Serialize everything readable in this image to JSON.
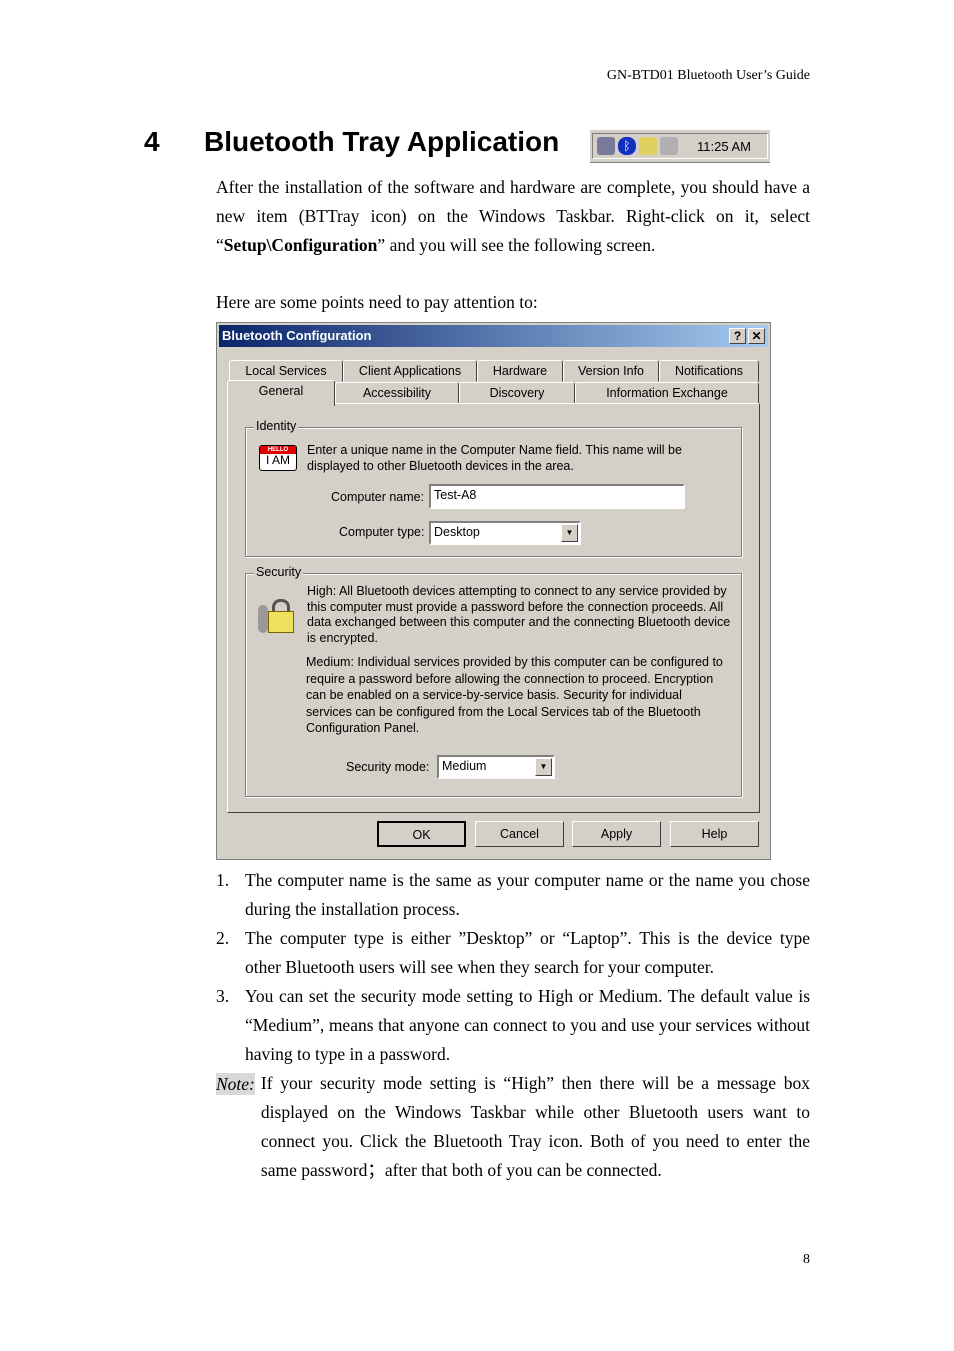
{
  "header": "GN-BTD01 Bluetooth User’s Guide",
  "section": {
    "number": "4",
    "title": "Bluetooth Tray Application"
  },
  "tray": {
    "icons": [
      "network-icon",
      "bluetooth-icon",
      "printer-icon",
      "tools-icon"
    ],
    "clock": "11:25 AM"
  },
  "intro_paragraph": {
    "before": "After the installation of the software and hardware are complete, you should have a new item (BTTray icon) on the Windows Taskbar. Right-click on it, select “",
    "bold": "Setup\\Configuration",
    "after": "” and you will see the following screen."
  },
  "points_intro": "Here are some points need to pay attention to:",
  "dialog": {
    "title": "Bluetooth Configuration",
    "help_btn": "?",
    "close_btn": "✕",
    "tabs_row1": [
      "Local Services",
      "Client Applications",
      "Hardware",
      "Version Info",
      "Notifications"
    ],
    "tabs_row2": [
      "General",
      "Accessibility",
      "Discovery",
      "Information Exchange"
    ],
    "active_tab": "General",
    "identity": {
      "legend": "Identity",
      "icon_text_top": "HELLO",
      "icon_text": "I AM",
      "description": "Enter a unique name in the Computer Name field. This name will be displayed to other Bluetooth devices in the area.",
      "name_label": "Computer name:",
      "name_value": "Test-A8",
      "type_label": "Computer type:",
      "type_value": "Desktop"
    },
    "security": {
      "legend": "Security",
      "high_text": "High: All Bluetooth devices attempting to connect to any service provided by this computer must provide a password before the connection proceeds. All data exchanged between this computer and the connecting Bluetooth device is encrypted.",
      "medium_text": "Medium: Individual services provided by this computer can be configured to require a password before allowing the connection to proceed. Encryption can be enabled on a service-by-service basis. Security for individual services can be configured from the Local Services tab of the Bluetooth Configuration Panel.",
      "mode_label": "Security mode:",
      "mode_value": "Medium"
    },
    "buttons": {
      "ok": "OK",
      "cancel": "Cancel",
      "apply": "Apply",
      "help": "Help"
    }
  },
  "list": [
    {
      "n": "1.",
      "text": "The computer name is the same as your computer name or the name you chose during the installation process."
    },
    {
      "n": "2.",
      "text": "The computer type is either ”Desktop” or “Laptop”. This is the device type other Bluetooth users will see when they search for your computer."
    },
    {
      "n": "3.",
      "text": "You can set the security mode setting to High or Medium. The default value is “Medium”, means that anyone can connect to you and use your services without having to type in a password."
    }
  ],
  "note": {
    "label": "Note:",
    "text": "If your security mode setting is “High” then there will be a message box displayed on the Windows Taskbar while other Bluetooth users want to connect you. Click the Bluetooth Tray icon. Both of you need to enter the same password；after that both of you can be connected."
  },
  "page_number": "8"
}
